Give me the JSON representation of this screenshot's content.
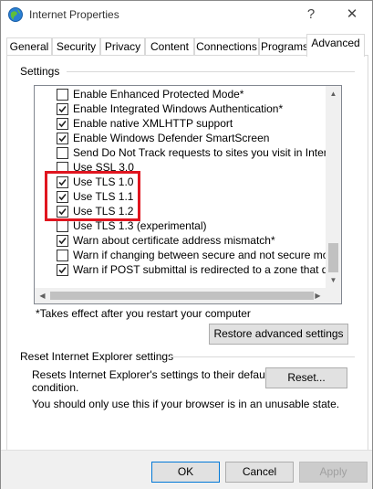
{
  "window": {
    "title": "Internet Properties",
    "help_glyph": "?",
    "close_glyph": "✕"
  },
  "tabs": [
    "General",
    "Security",
    "Privacy",
    "Content",
    "Connections",
    "Programs",
    "Advanced"
  ],
  "active_tab": "Advanced",
  "settings": {
    "group_label": "Settings",
    "items": [
      {
        "label": "Enable Enhanced Protected Mode*",
        "checked": false
      },
      {
        "label": "Enable Integrated Windows Authentication*",
        "checked": true
      },
      {
        "label": "Enable native XMLHTTP support",
        "checked": true
      },
      {
        "label": "Enable Windows Defender SmartScreen",
        "checked": true
      },
      {
        "label": "Send Do Not Track requests to sites you visit in Internet E",
        "checked": false
      },
      {
        "label": "Use SSL 3.0",
        "checked": false
      },
      {
        "label": "Use TLS 1.0",
        "checked": true
      },
      {
        "label": "Use TLS 1.1",
        "checked": true
      },
      {
        "label": "Use TLS 1.2",
        "checked": true
      },
      {
        "label": "Use TLS 1.3 (experimental)",
        "checked": false
      },
      {
        "label": "Warn about certificate address mismatch*",
        "checked": true
      },
      {
        "label": "Warn if changing between secure and not secure mode",
        "checked": false
      },
      {
        "label": "Warn if POST submittal is redirected to a zone that does n",
        "checked": true
      }
    ],
    "note": "*Takes effect after you restart your computer",
    "restore_button": "Restore advanced settings"
  },
  "reset": {
    "title": "Reset Internet Explorer settings",
    "description_line1": "Resets Internet Explorer's settings to their default",
    "description_line2": "condition.",
    "button": "Reset...",
    "warning": "You should only use this if your browser is in an unusable state."
  },
  "footer": {
    "ok": "OK",
    "cancel": "Cancel",
    "apply": "Apply"
  },
  "colors": {
    "highlight": "#e0151f",
    "accent": "#0078d7"
  }
}
